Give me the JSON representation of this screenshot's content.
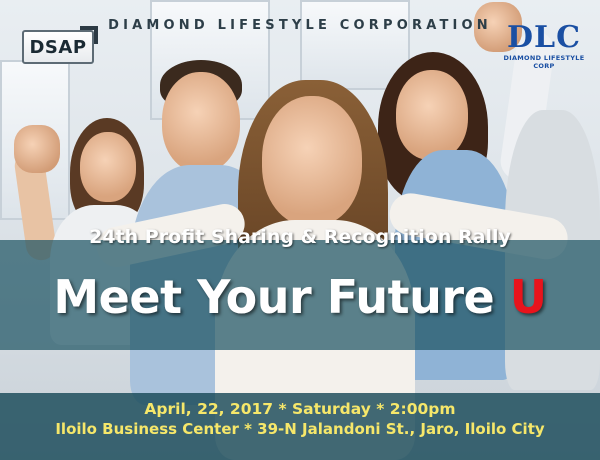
{
  "header": {
    "corporation_name": "DIAMOND LIFESTYLE CORPORATION"
  },
  "logos": {
    "left_logo_text": "DSAP",
    "right_logo_mark": "DLC",
    "right_logo_subtitle": "DIAMOND LIFESTYLE CORP"
  },
  "event": {
    "rally_title": "24th Profit Sharing & Recognition Rally",
    "headline_main": "Meet Your Future ",
    "headline_accent": "U",
    "date_line": "April, 22, 2017 * Saturday * 2:00pm",
    "venue_line": "Iloilo Business Center * 39-N Jalandoni St., Jaro, Iloilo City"
  },
  "colors": {
    "accent_red": "#e8141c",
    "event_text_yellow": "#f6e76a",
    "band_teal": "#1e5564",
    "logo_blue": "#1a4fa3"
  }
}
